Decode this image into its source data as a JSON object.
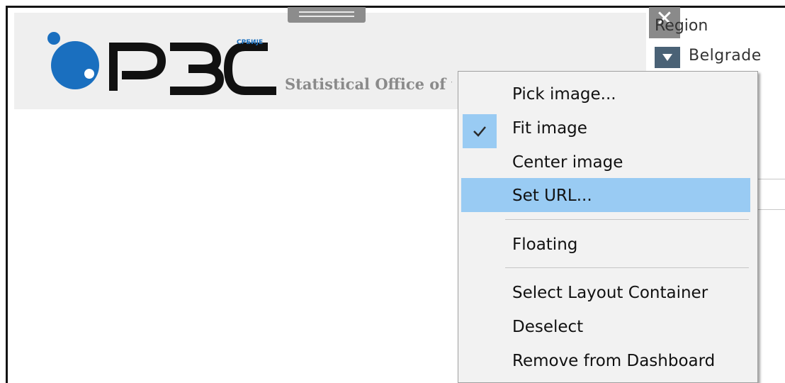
{
  "logo": {
    "name": "РЗС",
    "superscript": "СРБИЈЕ",
    "tagline": "Statistical Office of the Republic of Serbia",
    "brand_color": "#1a6fbf"
  },
  "image_container": {
    "close_icon": "close-icon",
    "close_glyph": "✕"
  },
  "filter": {
    "label": "Region",
    "value": "Belgrade",
    "dropdown_icon": "chevron-down-icon"
  },
  "context_menu": {
    "items": [
      {
        "label": "Pick image...",
        "checked": false,
        "highlighted": false
      },
      {
        "label": "Fit image",
        "checked": true,
        "highlighted": false
      },
      {
        "label": "Center image",
        "checked": false,
        "highlighted": false
      },
      {
        "label": "Set URL...",
        "checked": false,
        "highlighted": true
      },
      {
        "label": "Floating",
        "checked": false,
        "highlighted": false
      },
      {
        "label": "Select Layout Container",
        "checked": false,
        "highlighted": false
      },
      {
        "label": "Deselect",
        "checked": false,
        "highlighted": false
      },
      {
        "label": "Remove from Dashboard",
        "checked": false,
        "highlighted": false
      }
    ],
    "highlight_color": "#99cbf3",
    "check_icon": "checkmark-icon"
  }
}
